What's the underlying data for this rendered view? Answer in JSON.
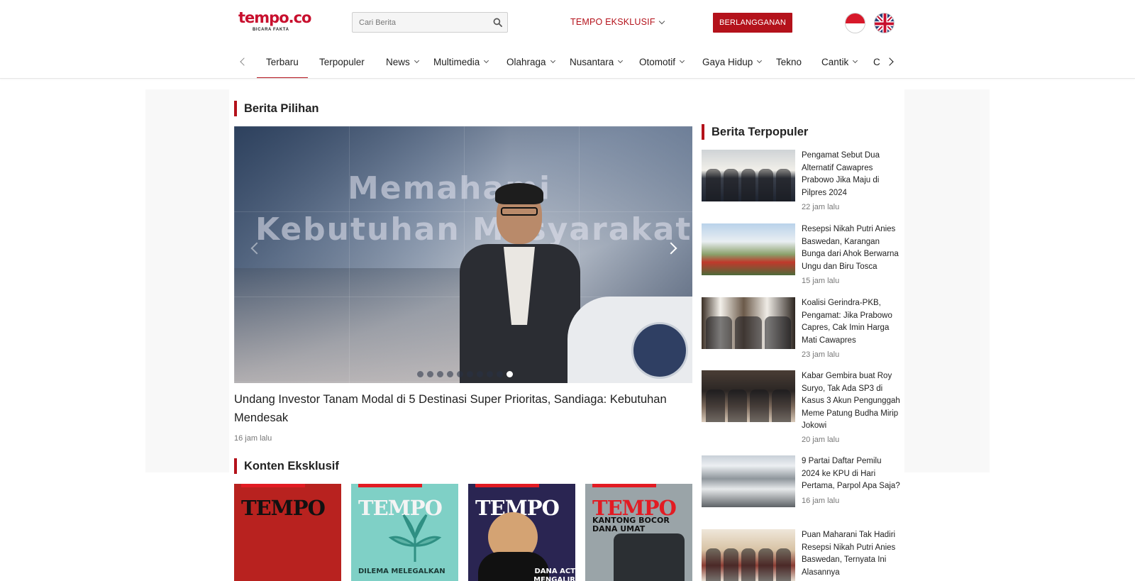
{
  "header": {
    "logo_text": "tempo.co",
    "logo_tagline": "BICARA FAKTA",
    "search_placeholder": "Cari Berita",
    "eksklusif_label": "TEMPO EKSKLUSIF",
    "subscribe_label": "BERLANGGANAN",
    "lang_options": [
      "id-flag-icon",
      "uk-flag-icon"
    ]
  },
  "nav": {
    "items": [
      {
        "label": "Terbaru",
        "dropdown": false,
        "active": true
      },
      {
        "label": "Terpopuler",
        "dropdown": false
      },
      {
        "label": "News",
        "dropdown": true
      },
      {
        "label": "Multimedia",
        "dropdown": true
      },
      {
        "label": "Olahraga",
        "dropdown": true
      },
      {
        "label": "Nusantara",
        "dropdown": true
      },
      {
        "label": "Otomotif",
        "dropdown": true
      },
      {
        "label": "Gaya Hidup",
        "dropdown": true
      },
      {
        "label": "Tekno",
        "dropdown": false
      },
      {
        "label": "Cantik",
        "dropdown": true
      },
      {
        "label": "C",
        "dropdown": false
      }
    ]
  },
  "main": {
    "pilihan_title": "Berita Pilihan",
    "hero": {
      "overlay_line1": "Memahami",
      "overlay_line2": "Kebutuhan Masyarakat",
      "title": "Undang Investor Tanam Modal di 5 Destinasi Super Prioritas, Sandiaga: Kebutuhan Mendesak",
      "time": "16 jam lalu",
      "slide_count": 10,
      "active_slide": 10
    },
    "eksklusif_title": "Konten Eksklusif",
    "covers": [
      {
        "masthead": "TEMPO",
        "caption": ""
      },
      {
        "masthead": "TEMPO",
        "caption": "DILEMA MELEGALKAN"
      },
      {
        "masthead": "TEMPO",
        "caption": "DANA ACT MENGALIR JAUH"
      },
      {
        "masthead": "TEMPO",
        "caption": "KANTONG BOCOR DANA UMAT"
      }
    ]
  },
  "sidebar": {
    "title": "Berita Terpopuler",
    "items": [
      {
        "title": "Pengamat Sebut Dua Alternatif Cawapres Prabowo Jika Maju di Pilpres 2024",
        "time": "22 jam lalu"
      },
      {
        "title": "Resepsi Nikah Putri Anies Baswedan, Karangan Bunga dari Ahok Berwarna Ungu dan Biru Tosca",
        "time": "15 jam lalu"
      },
      {
        "title": "Koalisi Gerindra-PKB, Pengamat: Jika Prabowo Capres, Cak Imin Harga Mati Cawapres",
        "time": "23 jam lalu"
      },
      {
        "title": "Kabar Gembira buat Roy Suryo, Tak Ada SP3 di Kasus 3 Akun Pengunggah Meme Patung Budha Mirip Jokowi",
        "time": "20 jam lalu"
      },
      {
        "title": "9 Partai Daftar Pemilu 2024 ke KPU di Hari Pertama, Parpol Apa Saja?",
        "time": "16 jam lalu"
      },
      {
        "title": "Puan Maharani Tak Hadiri Resepsi Nikah Putri Anies Baswedan, Ternyata Ini Alasannya",
        "time": ""
      }
    ]
  },
  "colors": {
    "brand_red": "#b4121b",
    "logo_red": "#c8102e"
  }
}
